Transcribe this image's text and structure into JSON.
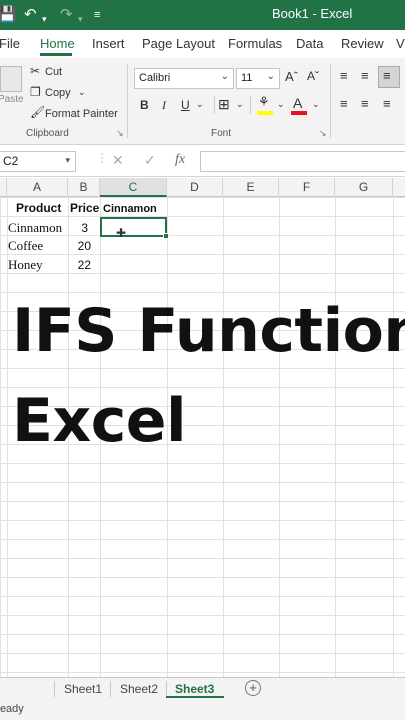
{
  "titlebar": {
    "title": "Book1  -  Excel"
  },
  "tabs": [
    "File",
    "Home",
    "Insert",
    "Page Layout",
    "Formulas",
    "Data",
    "Review",
    "V"
  ],
  "ribbon": {
    "paste_label": "Paste",
    "cut_label": "Cut",
    "copy_label": "Copy",
    "format_painter_label": "Format Painter",
    "clipboard_label": "Clipboard",
    "font_name": "Calibri",
    "font_size": "11",
    "bold": "B",
    "italic": "I",
    "underline": "U",
    "font_label": "Font"
  },
  "formula_bar": {
    "name_box": "C2",
    "fx": "fx"
  },
  "columns": [
    "A",
    "B",
    "C",
    "D",
    "E",
    "F",
    "G"
  ],
  "cells": {
    "A1": "Product",
    "B1": "Price",
    "C1": "Cinnamon",
    "A2": "Cinnamon",
    "B2": "3",
    "A3": "Coffee",
    "B3": "20",
    "A4": "Honey",
    "B4": "22"
  },
  "overlay": {
    "line1": "IFS Function",
    "line2": "Excel"
  },
  "sheets": [
    "Sheet1",
    "Sheet2",
    "Sheet3"
  ],
  "status": "Ready",
  "colors": {
    "accent": "#217346"
  }
}
